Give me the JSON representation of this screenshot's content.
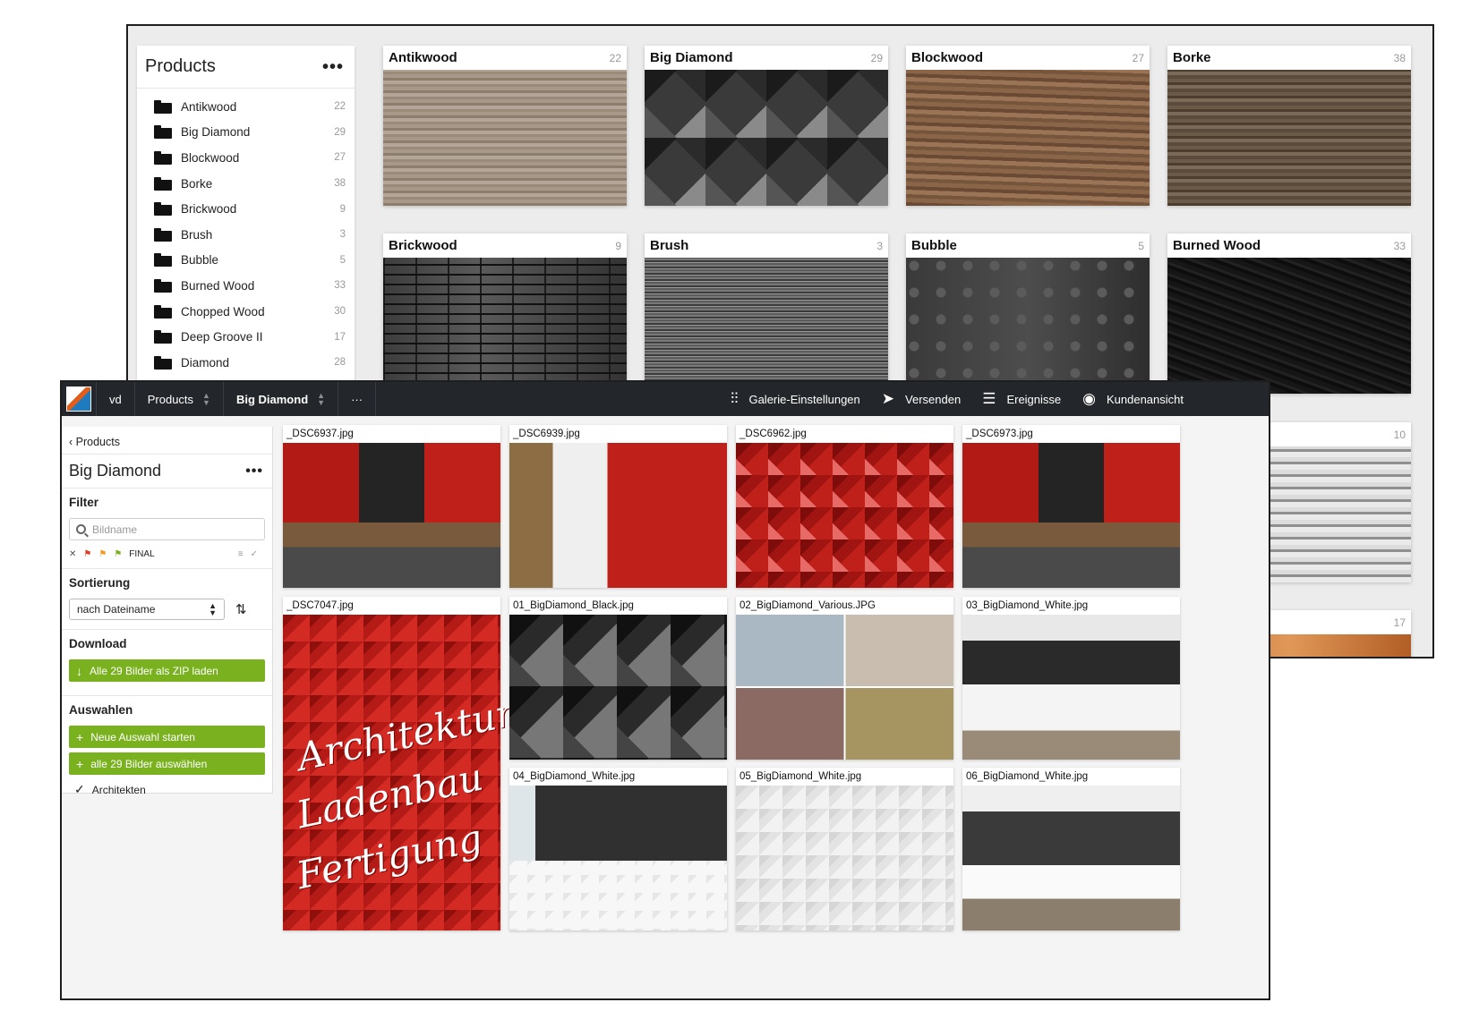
{
  "back_window": {
    "sidebar_title": "Products",
    "folders": [
      {
        "name": "Antikwood",
        "count": "22"
      },
      {
        "name": "Big Diamond",
        "count": "29"
      },
      {
        "name": "Blockwood",
        "count": "27"
      },
      {
        "name": "Borke",
        "count": "38"
      },
      {
        "name": "Brickwood",
        "count": "9"
      },
      {
        "name": "Brush",
        "count": "3"
      },
      {
        "name": "Bubble",
        "count": "5"
      },
      {
        "name": "Burned Wood",
        "count": "33"
      },
      {
        "name": "Chopped Wood",
        "count": "30"
      },
      {
        "name": "Deep Groove II",
        "count": "17"
      },
      {
        "name": "Diamond",
        "count": "28"
      }
    ],
    "tiles": [
      {
        "name": "Antikwood",
        "count": "22"
      },
      {
        "name": "Big Diamond",
        "count": "29"
      },
      {
        "name": "Blockwood",
        "count": "27"
      },
      {
        "name": "Borke",
        "count": "38"
      },
      {
        "name": "Brickwood",
        "count": "9"
      },
      {
        "name": "Brush",
        "count": "3"
      },
      {
        "name": "Bubble",
        "count": "5"
      },
      {
        "name": "Burned Wood",
        "count": "33"
      }
    ],
    "partial_counts": [
      "10",
      "17"
    ]
  },
  "topbar": {
    "home": "vd",
    "crumb1": "Products",
    "crumb2": "Big Diamond",
    "more": "···",
    "actions": {
      "gallery_settings": "Galerie-Einstellungen",
      "send": "Versenden",
      "events": "Ereignisse",
      "client_view": "Kundenansicht"
    }
  },
  "sidebar": {
    "back_link": "‹ Products",
    "title": "Big Diamond",
    "filter_heading": "Filter",
    "search_placeholder": "Bildname",
    "flag_final": "FINAL",
    "sort_heading": "Sortierung",
    "sort_value": "nach Dateiname",
    "download_heading": "Download",
    "download_button": "Alle 29 Bilder als ZIP laden",
    "select_heading": "Auswahlen",
    "new_selection_button": "Neue Auswahl starten",
    "select_all_button": "alle 29 Bilder auswählen",
    "selection_item": "Architekten"
  },
  "photos": [
    "_DSC6937.jpg",
    "_DSC6939.jpg",
    "_DSC6962.jpg",
    "_DSC6973.jpg",
    "_DSC7047.jpg",
    "01_BigDiamond_Black.jpg",
    "02_BigDiamond_Various.JPG",
    "03_BigDiamond_White.jpg",
    "04_BigDiamond_White.jpg",
    "05_BigDiamond_White.jpg",
    "06_BigDiamond_White.jpg"
  ],
  "graffiti": [
    "Architektur",
    "Ladenbau",
    "Fertigung"
  ]
}
